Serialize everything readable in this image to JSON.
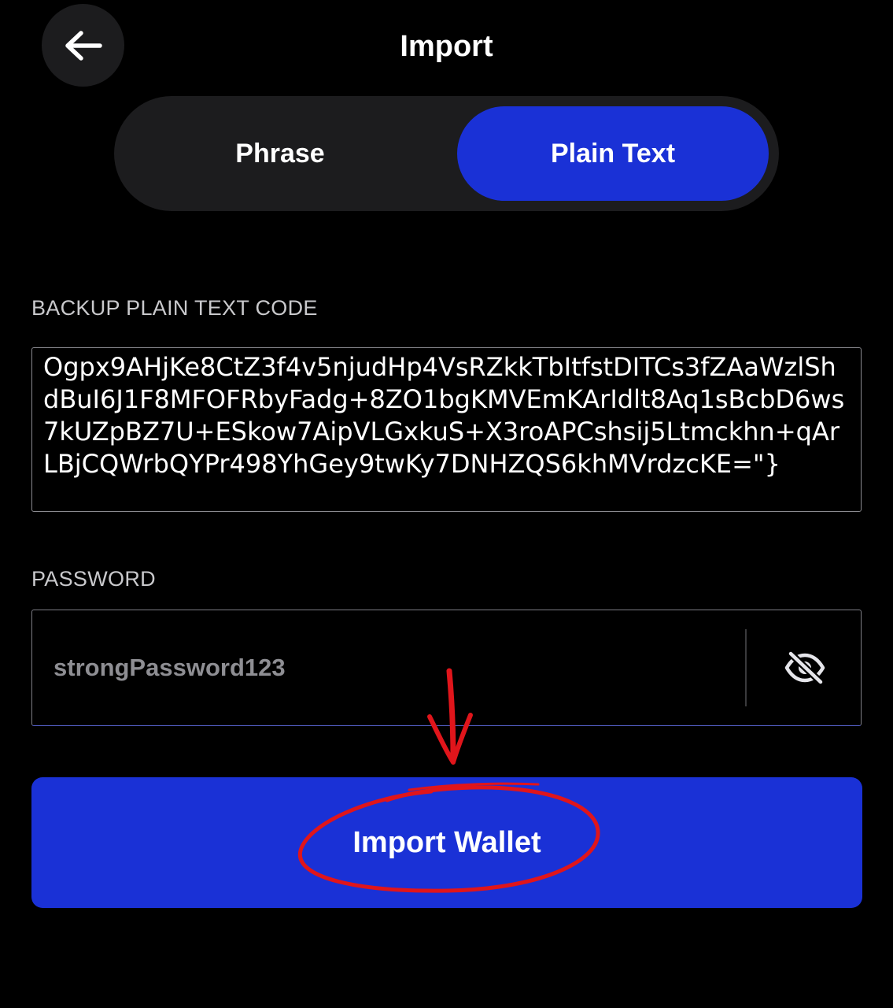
{
  "header": {
    "title": "Import",
    "back_icon": "arrow-left-icon"
  },
  "tabs": [
    {
      "label": "Phrase",
      "active": false
    },
    {
      "label": "Plain Text",
      "active": true
    }
  ],
  "backup": {
    "label": "BACKUP PLAIN TEXT CODE",
    "value": "Ogpx9AHjKe8CtZ3f4v5njudHp4VsRZkkTbItfstDITCs3fZAaWzlShdBuI6J1F8MFOFRbyFadg+8ZO1bgKMVEmKArIdlt8Aq1sBcbD6ws7kUZpBZ7U+ESkow7AipVLGxkuS+X3roAPCshsij5Ltmckhn+qArLBjCQWrbQYPr498YhGey9twKy7DNHZQS6khMVrdzcKE=\"}"
  },
  "password": {
    "label": "PASSWORD",
    "value": "strongPassword123",
    "toggle_icon": "eye-slash-icon"
  },
  "import_button": {
    "label": "Import Wallet"
  },
  "colors": {
    "background": "#000000",
    "accent": "#1a31d6",
    "surface": "#1c1c1e",
    "annotation": "#e0151b"
  }
}
